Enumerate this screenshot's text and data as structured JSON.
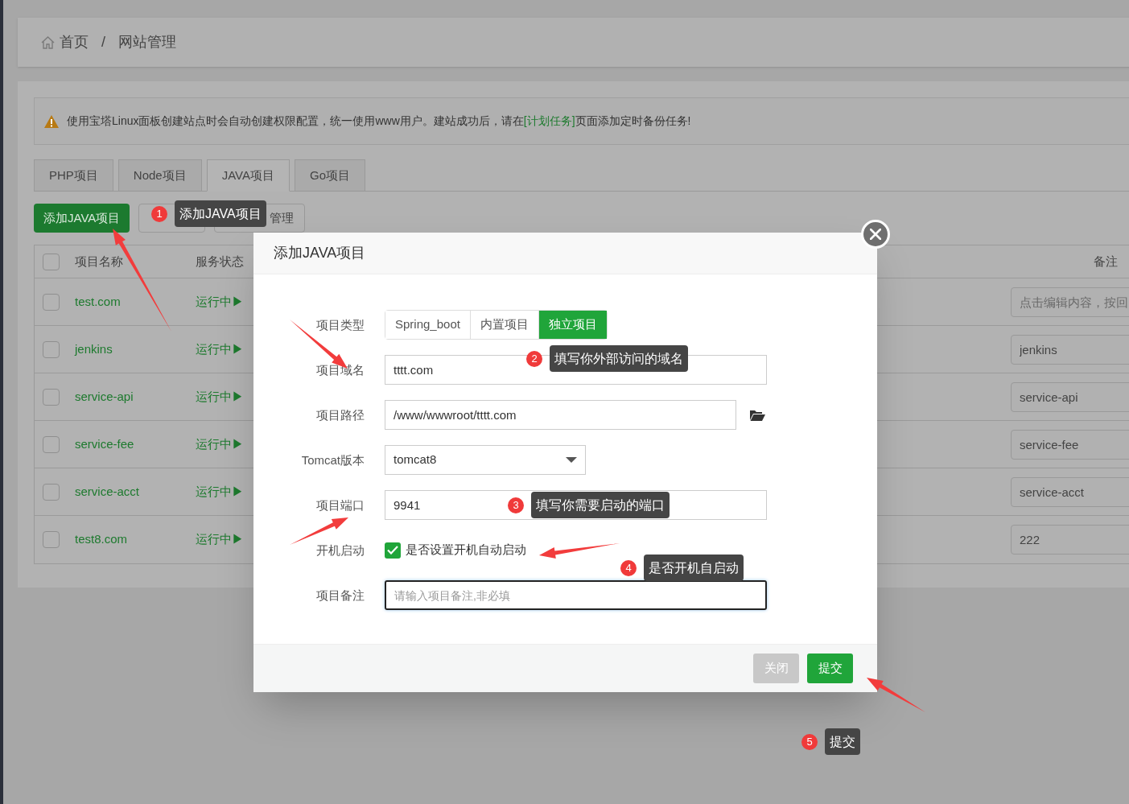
{
  "breadcrumb": {
    "items": [
      "首页",
      "网站管理"
    ],
    "separator": "/"
  },
  "alert": {
    "before": "使用宝塔Linux面板创建站点时会自动创建权限配置，统一使用www用户。建站成功后，请在",
    "link": "[计划任务]",
    "after": "页面添加定时备份任务!"
  },
  "tabs": [
    {
      "label": "PHP项目",
      "selected": false
    },
    {
      "label": "Node项目",
      "selected": false
    },
    {
      "label": "JAVA项目",
      "selected": true
    },
    {
      "label": "Go项目",
      "selected": false
    }
  ],
  "toolbar": [
    {
      "label": "添加JAVA项目",
      "kind": "primary"
    },
    {
      "kind": "default"
    },
    {
      "label": "管理",
      "kind": "covered"
    }
  ],
  "table": {
    "header_checked": false,
    "columns": [
      "项目名称",
      "服务状态",
      "备注"
    ],
    "rows": [
      {
        "checked": false,
        "name": "test.com",
        "status": "运行中▶",
        "remark_placeholder": "点击编辑内容，按回"
      },
      {
        "checked": false,
        "name": "jenkins",
        "status": "运行中▶",
        "remark": "jenkins"
      },
      {
        "checked": false,
        "name": "service-api",
        "status": "运行中▶",
        "remark": "service-api"
      },
      {
        "checked": false,
        "name": "service-fee",
        "status": "运行中▶",
        "remark": "service-fee"
      },
      {
        "checked": false,
        "name": "service-acct",
        "status": "运行中▶",
        "remark": "service-acct"
      },
      {
        "checked": false,
        "name": "test8.com",
        "status": "运行中▶",
        "remark": "222"
      }
    ]
  },
  "modal": {
    "title": "添加JAVA项目",
    "fields": [
      {
        "kind": "segmented",
        "label": "项目类型",
        "options": [
          {
            "label": "Spring_boot",
            "selected": false
          },
          {
            "label": "内置项目",
            "selected": false
          },
          {
            "label": "独立项目",
            "selected": true
          }
        ]
      },
      {
        "kind": "text",
        "label": "项目域名",
        "value": "tttt.com"
      },
      {
        "kind": "path",
        "label": "项目路径",
        "value": "/www/wwwroot/tttt.com"
      },
      {
        "kind": "select",
        "label": "Tomcat版本",
        "value": "tomcat8"
      },
      {
        "kind": "text",
        "label": "项目端口",
        "value": "9941"
      },
      {
        "kind": "checkbox",
        "label": "开机启动",
        "checked": true,
        "text": "是否设置开机自动启动"
      },
      {
        "kind": "text",
        "label": "项目备注",
        "placeholder": "请输入项目备注,非必填",
        "focused": true
      }
    ],
    "buttons": [
      {
        "label": "关闭",
        "kind": "secondary"
      },
      {
        "label": "提交",
        "kind": "primary"
      }
    ]
  },
  "annotations": [
    {
      "number": "1",
      "text": "添加JAVA项目"
    },
    {
      "number": "2",
      "text": "填写你外部访问的域名"
    },
    {
      "number": "3",
      "text": "填写你需要启动的端口"
    },
    {
      "number": "4",
      "text": "是否开机自启动"
    },
    {
      "number": "5",
      "text": "提交"
    }
  ]
}
